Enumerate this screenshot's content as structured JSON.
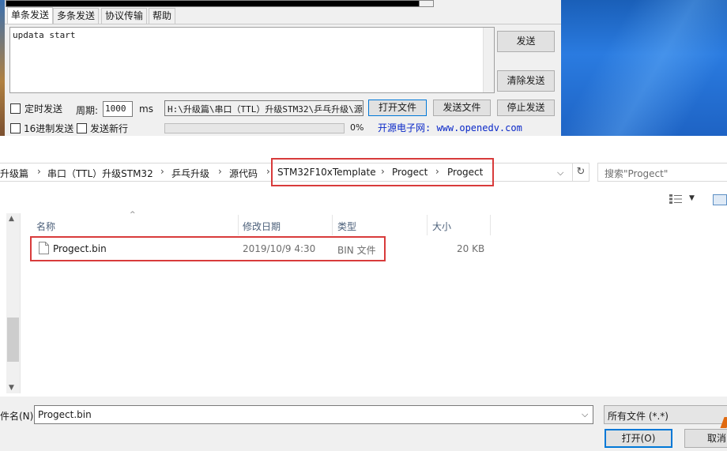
{
  "serial_tool": {
    "tabs": [
      "单条发送",
      "多条发送",
      "协议传输",
      "帮助"
    ],
    "send_text": "updata start",
    "send_button": "发送",
    "clear_button": "清除发送",
    "timed_send_label": "定时发送",
    "period_label": "周期:",
    "period_value": "1000",
    "period_unit": "ms",
    "file_path": "H:\\升级篇\\串口（TTL）升级STM32\\乒乓升级\\源",
    "open_file_button": "打开文件",
    "send_file_button": "发送文件",
    "stop_send_button": "停止发送",
    "hex_send_label": "16进制发送",
    "send_newline_label": "发送新行",
    "progress_percent": "0%",
    "progress_value": 0,
    "site_text": "开源电子网: www.openedv.com"
  },
  "file_dialog": {
    "breadcrumb": [
      "升级篇",
      "串口（TTL）升级STM32",
      "乒乓升级",
      "源代码",
      "STM32F10xTemplate",
      "Progect",
      "Progect"
    ],
    "search_placeholder": "搜索\"Progect\"",
    "columns": {
      "name": "名称",
      "date": "修改日期",
      "type": "类型",
      "size": "大小"
    },
    "files": [
      {
        "name": "Progect.bin",
        "date": "2019/10/9 4:30",
        "type": "BIN 文件",
        "size": "20 KB"
      }
    ],
    "filename_label": "件名(N):",
    "filename_value": "Progect.bin",
    "filter_value": "所有文件 (*.*)",
    "open_button": "打开(O)",
    "cancel_button": "取消"
  },
  "icons": {
    "file": "file-icon",
    "refresh": "refresh-icon",
    "view": "view-mode-icon",
    "preview_pane": "preview-pane-icon"
  },
  "colors": {
    "highlight_border": "#d83b3b",
    "link": "#0a28c8",
    "focus_border": "#0078d7"
  }
}
